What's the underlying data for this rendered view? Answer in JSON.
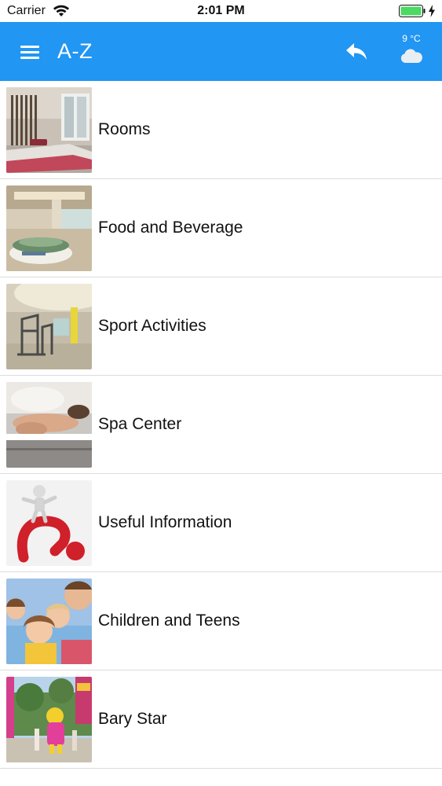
{
  "status_bar": {
    "carrier": "Carrier",
    "time": "2:01 PM"
  },
  "app_bar": {
    "title": "A-Z",
    "background_color": "#2196f3",
    "temperature": "9 °C",
    "icons": [
      "menu-icon",
      "reply-icon",
      "cloud-icon"
    ]
  },
  "list": {
    "items": [
      {
        "label": "Rooms",
        "icon": "rooms-photo"
      },
      {
        "label": "Food and Beverage",
        "icon": "food-photo"
      },
      {
        "label": "Sport Activities",
        "icon": "gym-photo"
      },
      {
        "label": "Spa Center",
        "icon": "spa-photo"
      },
      {
        "label": "Useful Information",
        "icon": "info-photo"
      },
      {
        "label": "Children and Teens",
        "icon": "children-photo"
      },
      {
        "label": "Bary Star",
        "icon": "mascot-photo"
      }
    ]
  }
}
